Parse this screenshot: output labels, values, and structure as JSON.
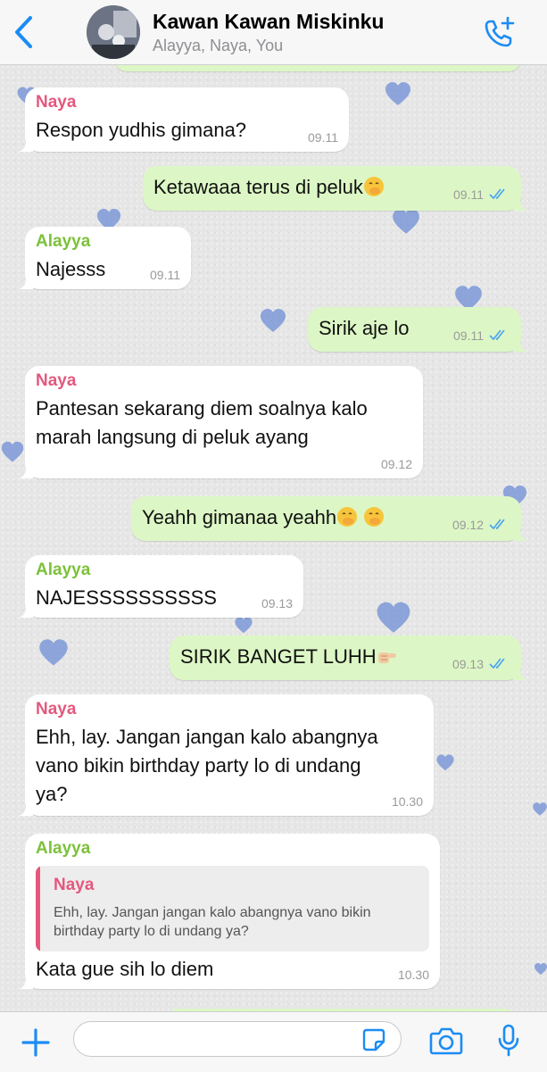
{
  "header": {
    "title": "Kawan Kawan Miskinku",
    "subtitle": "Alayya, Naya, You",
    "icons": {
      "back": "chevron-left-icon",
      "call": "phone-add-icon"
    }
  },
  "colors": {
    "accent": "#1b8cf5",
    "incoming_bubble": "#ffffff",
    "outgoing_bubble": "#dcf7c5",
    "sender_naya": "#e4587d",
    "sender_alayya": "#7cc13a",
    "read_ticks": "#4aa3f0"
  },
  "messages": [
    {
      "direction": "in",
      "sender": "Naya",
      "text": "Respon yudhis gimana?",
      "time": "09.11"
    },
    {
      "direction": "out",
      "text": "Ketawaaa terus di peluk",
      "emoji": [
        "face-with-hand-over-mouth"
      ],
      "time": "09.11",
      "status": "read"
    },
    {
      "direction": "in",
      "sender": "Alayya",
      "text": "Najesss",
      "time": "09.11"
    },
    {
      "direction": "out",
      "text": "Sirik aje lo",
      "time": "09.11",
      "status": "read"
    },
    {
      "direction": "in",
      "sender": "Naya",
      "lines": [
        "Pantesan sekarang diem soalnya kalo",
        "marah langsung di peluk ayang"
      ],
      "time": "09.12"
    },
    {
      "direction": "out",
      "text": "Yeahh gimanaa yeahh",
      "emoji": [
        "face-with-hand-over-mouth",
        "face-with-hand-over-mouth"
      ],
      "time": "09.12",
      "status": "read"
    },
    {
      "direction": "in",
      "sender": "Alayya",
      "text": "NAJESSSSSSSSSS",
      "time": "09.13"
    },
    {
      "direction": "out",
      "text": "SIRIK BANGET LUHH",
      "emoji": [
        "backhand-index-pointing-right"
      ],
      "time": "09.13",
      "status": "read"
    },
    {
      "direction": "in",
      "sender": "Naya",
      "lines": [
        "Ehh, lay. Jangan jangan kalo abangnya",
        "vano bikin birthday party lo di undang",
        "ya?"
      ],
      "time": "10.30"
    },
    {
      "direction": "in",
      "sender": "Alayya",
      "reply": {
        "name": "Naya",
        "text": "Ehh, lay. Jangan jangan kalo abangnya vano bikin birthday party lo di undang ya?"
      },
      "text": "Kata gue sih lo diem",
      "time": "10.30"
    }
  ],
  "composer": {
    "placeholder": "",
    "icons": [
      "plus-icon",
      "sticker-icon",
      "camera-icon",
      "microphone-icon"
    ]
  }
}
